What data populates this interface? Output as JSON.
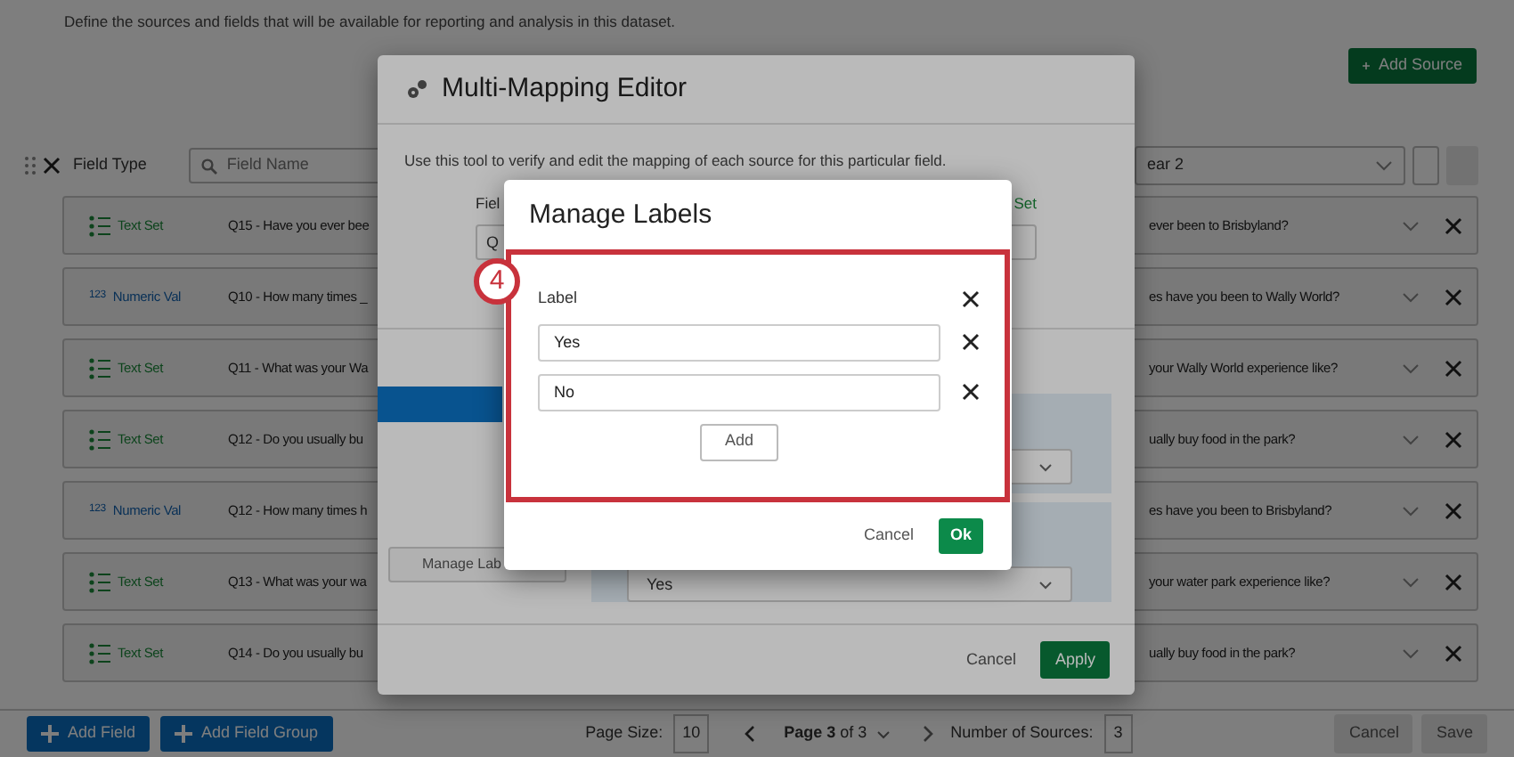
{
  "page": {
    "description": "Define the sources and fields that will be available for reporting and analysis in this dataset.",
    "add_source": "Add Source"
  },
  "filters": {
    "field_type": "Field Type",
    "search_placeholder": "Field Name",
    "source_select": "ear 2"
  },
  "fields": [
    {
      "kind": "text-set",
      "type": "Text Set",
      "question": "Q15 - Have you ever bee",
      "mapping": "ever been to Brisbyland?"
    },
    {
      "kind": "numeric",
      "icon": "123",
      "type": "Numeric Val",
      "question": "Q10 - How many times _",
      "mapping": "es have you been to Wally World?"
    },
    {
      "kind": "text-set",
      "type": "Text Set",
      "question": "Q11 - What was your Wa",
      "mapping": "your Wally World experience like?"
    },
    {
      "kind": "text-set",
      "type": "Text Set",
      "question": "Q12 - Do you usually bu",
      "mapping": "ually buy food in the park?"
    },
    {
      "kind": "numeric",
      "icon": "123",
      "type": "Numeric Val",
      "question": "Q12 - How many times h",
      "mapping": "es have you been to Brisbyland?"
    },
    {
      "kind": "text-set",
      "type": "Text Set",
      "question": "Q13 - What was your wa",
      "mapping": "your water park experience like?"
    },
    {
      "kind": "text-set",
      "type": "Text Set",
      "question": "Q14 - Do you usually bu",
      "mapping": "ually buy food in the park?"
    }
  ],
  "footer": {
    "add_field": "Add Field",
    "add_field_group": "Add Field Group",
    "page_size_label": "Page Size:",
    "page_size": "10",
    "page": "**Page 3** of 3",
    "sources_label": "Number of Sources:",
    "sources": "3",
    "actions": [
      {
        "label": "Cancel",
        "disabled": true
      },
      {
        "label": "Save",
        "disabled": true
      }
    ]
  },
  "mapping_editor": {
    "title": "Multi-Mapping Editor",
    "description": "Use this tool to verify and edit the mapping of each source for this particular field.",
    "field_label": "Fiel",
    "field_value": "Q",
    "type_label": "Set",
    "manage_labels_button": "Manage Lab",
    "label_value": "Yes",
    "cancel": "Cancel",
    "apply": "Apply"
  },
  "manage_labels": {
    "title": "Manage Labels",
    "step": "4",
    "column_label": "Label",
    "labels": [
      "Yes",
      "No"
    ],
    "add": "Add",
    "cancel": "Cancel",
    "ok": "Ok"
  }
}
